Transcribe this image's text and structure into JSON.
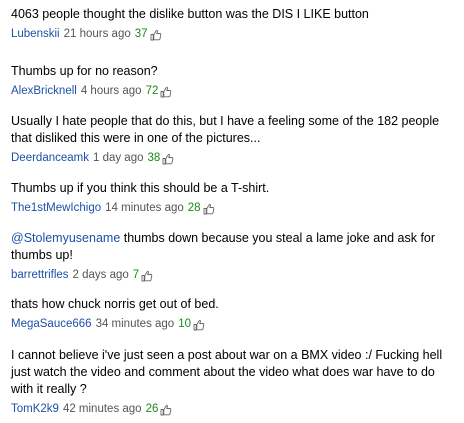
{
  "comments": [
    {
      "text": "4063 people thought the dislike button was the DIS I LIKE button",
      "author": "Lubenskii",
      "time": "21 hours ago",
      "score": "37",
      "icon": "thumbs-up-icon"
    },
    {
      "text": "Thumbs up for no reason?",
      "author": "AlexBricknell",
      "time": "4 hours ago",
      "score": "72",
      "icon": "thumbs-up-icon"
    },
    {
      "text": "Usually I hate people that do this, but I have a feeling some of the 182 people that disliked this were in one of the pictures...",
      "author": "Deerdanceamk",
      "time": "1 day ago",
      "score": "38",
      "icon": "thumbs-up-icon"
    },
    {
      "text": "Thumbs up if you think this should be a T-shirt.",
      "author": "The1stMewIchigo",
      "time": "14 minutes ago",
      "score": "28",
      "icon": "thumbs-up-icon"
    },
    {
      "mention": "@Stolemyusename",
      "text": " thumbs down because you steal a lame joke and ask for thumbs up!",
      "author": "barrettrifles",
      "time": "2 days ago",
      "score": "7",
      "icon": "thumbs-up-icon"
    },
    {
      "text": "thats how chuck norris get out of bed.",
      "author": "MegaSauce666",
      "time": "34 minutes ago",
      "score": "10",
      "icon": "thumbs-up-icon"
    },
    {
      "text": "I cannot believe i've just seen a post about war on a BMX video :/ Fucking hell just watch the video and comment about the video what does war have to do with it really ?",
      "author": "TomK2k9",
      "time": "42 minutes ago",
      "score": "26",
      "icon": "thumbs-up-icon"
    }
  ],
  "colors": {
    "link": "#1c51a8",
    "score": "#1a8a1a",
    "time": "#555555",
    "text": "#000000"
  }
}
